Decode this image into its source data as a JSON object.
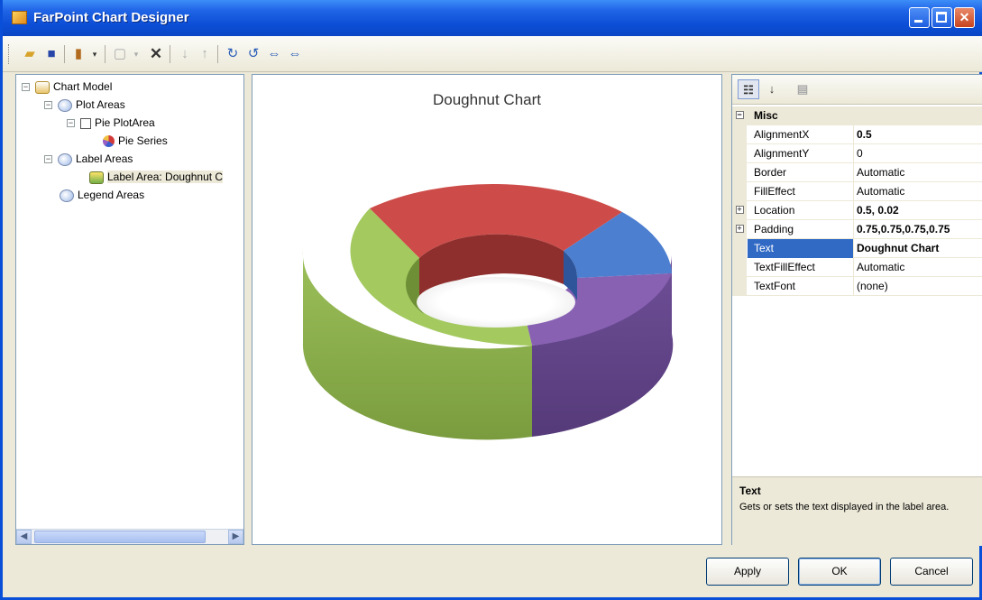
{
  "window": {
    "title": "FarPoint Chart Designer"
  },
  "toolbar": {
    "icons": [
      "open-folder-icon",
      "save-icon",
      "chart-type-icon",
      "dropdown-icon",
      "copy-icon",
      "dropdown-icon",
      "delete-icon",
      "move-down-icon",
      "move-up-icon",
      "rotate-cw-icon",
      "rotate-ccw-icon",
      "shift-left-icon",
      "shift-right-icon"
    ]
  },
  "tree": {
    "items": [
      {
        "label": "Chart Model",
        "level": 0,
        "expander": "−"
      },
      {
        "label": "Plot Areas",
        "level": 1,
        "expander": "−"
      },
      {
        "label": "Pie PlotArea",
        "level": 2,
        "expander": "−"
      },
      {
        "label": "Pie Series",
        "level": 3,
        "expander": ""
      },
      {
        "label": "Label Areas",
        "level": 1,
        "expander": "−"
      },
      {
        "label": "Label Area: Doughnut C",
        "level": 2,
        "expander": ""
      },
      {
        "label": "Legend Areas",
        "level": 1,
        "expander": ""
      }
    ]
  },
  "chart_data": {
    "type": "pie",
    "title": "Doughnut Chart",
    "style": "3d-doughnut",
    "slices": [
      {
        "color": "#cf4a47"
      },
      {
        "color": "#4c7fd0"
      },
      {
        "color": "#7e5aa8"
      },
      {
        "color": "#9cbf55"
      }
    ]
  },
  "properties": {
    "category": "Misc",
    "rows": [
      {
        "name": "AlignmentX",
        "value": "0.5",
        "bold": true
      },
      {
        "name": "AlignmentY",
        "value": "0",
        "bold": false
      },
      {
        "name": "Border",
        "value": "Automatic",
        "bold": false
      },
      {
        "name": "FillEffect",
        "value": "Automatic",
        "bold": false
      },
      {
        "name": "Location",
        "value": "0.5, 0.02",
        "bold": true,
        "expandable": true
      },
      {
        "name": "Padding",
        "value": "0.75,0.75,0.75,0.75",
        "bold": true,
        "expandable": true
      },
      {
        "name": "Text",
        "value": "Doughnut Chart",
        "bold": true,
        "selected": true
      },
      {
        "name": "TextFillEffect",
        "value": "Automatic",
        "bold": false
      },
      {
        "name": "TextFont",
        "value": "(none)",
        "bold": false
      }
    ],
    "description": {
      "title": "Text",
      "text": "Gets or sets the text displayed in the label area."
    }
  },
  "buttons": {
    "apply": "Apply",
    "ok": "OK",
    "cancel": "Cancel"
  }
}
